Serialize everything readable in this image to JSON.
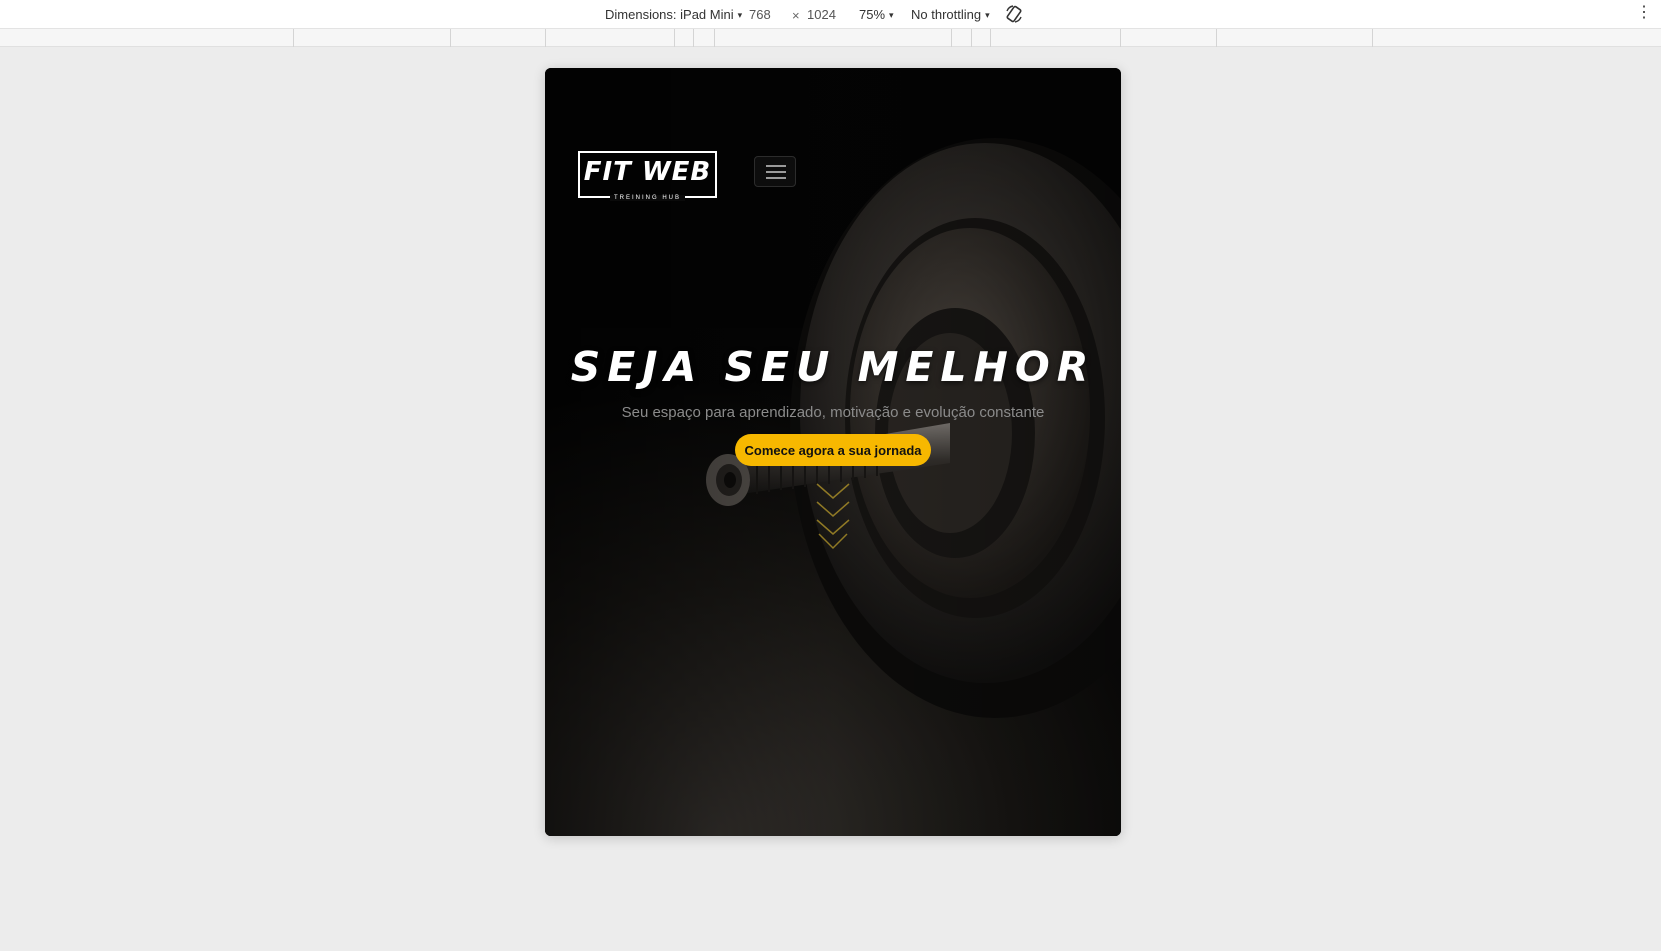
{
  "devtools": {
    "dimensions_label": "Dimensions: iPad Mini",
    "width_value": "768",
    "times_symbol": "×",
    "height_value": "1024",
    "zoom": "75%",
    "throttling": "No throttling",
    "caret": "▾",
    "more_symbol": "⋮"
  },
  "page": {
    "brand": {
      "name": "FIT WEB",
      "tagline": "TREINING HUB"
    },
    "hero": {
      "title": "SEJA SEU MELHOR",
      "subtitle": "Seu espaço para aprendizado, motivação e evolução constante",
      "cta_label": "Comece agora a sua jornada"
    }
  },
  "colors": {
    "accent": "#f7b800",
    "hero_text": "#ffffff",
    "subtitle_text": "#8b8b8b",
    "toolbar_bg": "#ffffff",
    "page_bg": "#ececec"
  },
  "icons": {
    "menu": "hamburger-icon",
    "scroll": "chevrons-down-icon",
    "rotate": "rotate-device-icon",
    "more": "more-vertical-icon"
  }
}
